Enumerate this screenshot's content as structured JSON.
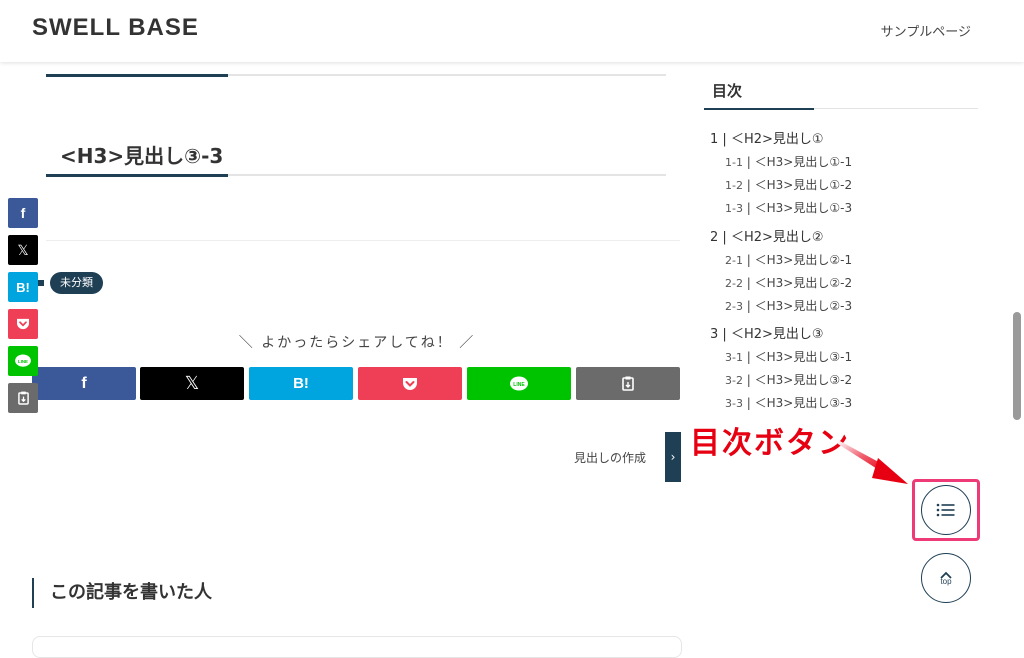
{
  "header": {
    "site_title": "SWELL BASE",
    "nav_item": "サンプルページ"
  },
  "article": {
    "h3_heading": "<H3>見出し③-3",
    "category_badge": "未分類",
    "share_message": "＼ よかったらシェアしてね！ ／",
    "next_post_label": "見出しの作成",
    "next_post_arrow": "›",
    "author_heading": "この記事を書いた人"
  },
  "share_buttons": [
    {
      "name": "facebook",
      "label": "f",
      "color": "#3b5998"
    },
    {
      "name": "x",
      "label": "𝕏",
      "color": "#000000"
    },
    {
      "name": "hatena",
      "label": "B!",
      "color": "#00a4de"
    },
    {
      "name": "pocket",
      "label": "pocket",
      "color": "#ef3f56"
    },
    {
      "name": "line",
      "label": "LINE",
      "color": "#00c300"
    },
    {
      "name": "copy",
      "label": "copy",
      "color": "#6b6b6b"
    }
  ],
  "toc": {
    "title": "目次",
    "sections": [
      {
        "num": "1",
        "label": "＜H2>見出し①",
        "items": [
          {
            "num": "1-1",
            "label": "＜H3>見出し①-1"
          },
          {
            "num": "1-2",
            "label": "＜H3>見出し①-2"
          },
          {
            "num": "1-3",
            "label": "＜H3>見出し①-3"
          }
        ]
      },
      {
        "num": "2",
        "label": "＜H2>見出し②",
        "items": [
          {
            "num": "2-1",
            "label": "＜H3>見出し②-1"
          },
          {
            "num": "2-2",
            "label": "＜H3>見出し②-2"
          },
          {
            "num": "2-3",
            "label": "＜H3>見出し②-3"
          }
        ]
      },
      {
        "num": "3",
        "label": "＜H2>見出し③",
        "items": [
          {
            "num": "3-1",
            "label": "＜H3>見出し③-1"
          },
          {
            "num": "3-2",
            "label": "＜H3>見出し③-2"
          },
          {
            "num": "3-3",
            "label": "＜H3>見出し③-3"
          }
        ]
      }
    ]
  },
  "annotation": {
    "text": "目次ボタン",
    "color": "#e60012",
    "box_color": "#ee3b77"
  },
  "floating": {
    "toc_button_icon": "list-icon",
    "top_button_label": "top"
  },
  "colors": {
    "accent": "#1f3f55"
  }
}
